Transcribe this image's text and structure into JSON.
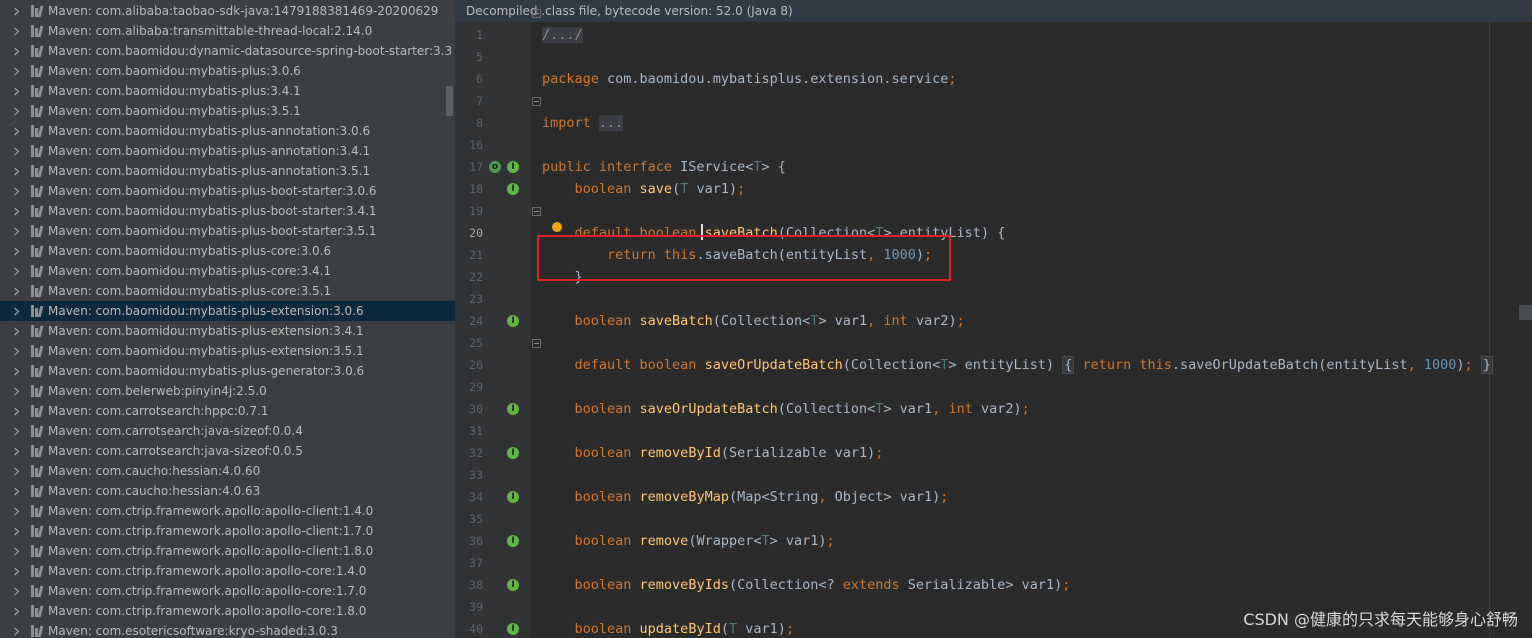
{
  "tree": {
    "items": [
      {
        "label": "Maven: com.alibaba:taobao-sdk-java:1479188381469-20200629"
      },
      {
        "label": "Maven: com.alibaba:transmittable-thread-local:2.14.0"
      },
      {
        "label": "Maven: com.baomidou:dynamic-datasource-spring-boot-starter:3.3"
      },
      {
        "label": "Maven: com.baomidou:mybatis-plus:3.0.6"
      },
      {
        "label": "Maven: com.baomidou:mybatis-plus:3.4.1"
      },
      {
        "label": "Maven: com.baomidou:mybatis-plus:3.5.1"
      },
      {
        "label": "Maven: com.baomidou:mybatis-plus-annotation:3.0.6"
      },
      {
        "label": "Maven: com.baomidou:mybatis-plus-annotation:3.4.1"
      },
      {
        "label": "Maven: com.baomidou:mybatis-plus-annotation:3.5.1"
      },
      {
        "label": "Maven: com.baomidou:mybatis-plus-boot-starter:3.0.6"
      },
      {
        "label": "Maven: com.baomidou:mybatis-plus-boot-starter:3.4.1"
      },
      {
        "label": "Maven: com.baomidou:mybatis-plus-boot-starter:3.5.1"
      },
      {
        "label": "Maven: com.baomidou:mybatis-plus-core:3.0.6"
      },
      {
        "label": "Maven: com.baomidou:mybatis-plus-core:3.4.1"
      },
      {
        "label": "Maven: com.baomidou:mybatis-plus-core:3.5.1"
      },
      {
        "label": "Maven: com.baomidou:mybatis-plus-extension:3.0.6",
        "selected": true
      },
      {
        "label": "Maven: com.baomidou:mybatis-plus-extension:3.4.1"
      },
      {
        "label": "Maven: com.baomidou:mybatis-plus-extension:3.5.1"
      },
      {
        "label": "Maven: com.baomidou:mybatis-plus-generator:3.0.6"
      },
      {
        "label": "Maven: com.belerweb:pinyin4j:2.5.0"
      },
      {
        "label": "Maven: com.carrotsearch:hppc:0.7.1"
      },
      {
        "label": "Maven: com.carrotsearch:java-sizeof:0.0.4"
      },
      {
        "label": "Maven: com.carrotsearch:java-sizeof:0.0.5"
      },
      {
        "label": "Maven: com.caucho:hessian:4.0.60"
      },
      {
        "label": "Maven: com.caucho:hessian:4.0.63"
      },
      {
        "label": "Maven: com.ctrip.framework.apollo:apollo-client:1.4.0"
      },
      {
        "label": "Maven: com.ctrip.framework.apollo:apollo-client:1.7.0"
      },
      {
        "label": "Maven: com.ctrip.framework.apollo:apollo-client:1.8.0"
      },
      {
        "label": "Maven: com.ctrip.framework.apollo:apollo-core:1.4.0"
      },
      {
        "label": "Maven: com.ctrip.framework.apollo:apollo-core:1.7.0"
      },
      {
        "label": "Maven: com.ctrip.framework.apollo:apollo-core:1.8.0"
      },
      {
        "label": "Maven: com.esotericsoftware:kryo-shaded:3.0.3"
      }
    ],
    "icons": {
      "expand": "chevron-right-icon",
      "library": "library-icon"
    }
  },
  "editor": {
    "banner": "Decompiled .class file, bytecode version: 52.0 (Java 8)",
    "current_line": "20",
    "lines": [
      {
        "num": "1",
        "gicons": [],
        "fold": true,
        "tokens": [
          {
            "t": "/.../",
            "c": "folded"
          }
        ]
      },
      {
        "num": "5",
        "gicons": [],
        "fold": false,
        "tokens": []
      },
      {
        "num": "6",
        "gicons": [],
        "fold": false,
        "tokens": [
          {
            "t": "package ",
            "c": "kw"
          },
          {
            "t": "com.baomidou.mybatisplus.extension.service",
            "c": ""
          },
          {
            "t": ";",
            "c": "kw"
          }
        ]
      },
      {
        "num": "7",
        "gicons": [],
        "fold": false,
        "tokens": []
      },
      {
        "num": "8",
        "gicons": [],
        "fold": true,
        "tokens": [
          {
            "t": "import ",
            "c": "kw"
          },
          {
            "t": "...",
            "c": "folded"
          }
        ]
      },
      {
        "num": "16",
        "gicons": [],
        "fold": false,
        "tokens": []
      },
      {
        "num": "17",
        "gicons": [
          "hier",
          "impl"
        ],
        "fold": false,
        "tokens": [
          {
            "t": "public interface ",
            "c": "kw"
          },
          {
            "t": "IService<",
            "c": ""
          },
          {
            "t": "T",
            "c": "tp"
          },
          {
            "t": "> {",
            "c": ""
          }
        ]
      },
      {
        "num": "18",
        "gicons": [
          "impl"
        ],
        "fold": false,
        "tokens": [
          {
            "t": "    boolean ",
            "c": "kw"
          },
          {
            "t": "save",
            "c": "fn"
          },
          {
            "t": "(",
            "c": ""
          },
          {
            "t": "T",
            "c": "tp"
          },
          {
            "t": " var1)",
            "c": ""
          },
          {
            "t": ";",
            "c": "kw"
          }
        ]
      },
      {
        "num": "19",
        "gicons": [],
        "fold": false,
        "tokens": []
      },
      {
        "num": "20",
        "gicons": [],
        "fold": true,
        "tokens": [
          {
            "t": "    default boolean ",
            "c": "kw"
          },
          {
            "t": "saveBatch",
            "c": "fn"
          },
          {
            "t": "(Collection<",
            "c": ""
          },
          {
            "t": "T",
            "c": "tp"
          },
          {
            "t": "> entityList) {",
            "c": ""
          }
        ]
      },
      {
        "num": "21",
        "gicons": [],
        "fold": false,
        "tokens": [
          {
            "t": "        return this",
            "c": "kw"
          },
          {
            "t": ".saveBatch(entityList",
            "c": ""
          },
          {
            "t": ", ",
            "c": "kw"
          },
          {
            "t": "1000",
            "c": "num"
          },
          {
            "t": ")",
            "c": ""
          },
          {
            "t": ";",
            "c": "kw"
          }
        ]
      },
      {
        "num": "22",
        "gicons": [],
        "fold": false,
        "tokens": [
          {
            "t": "    }",
            "c": ""
          }
        ]
      },
      {
        "num": "23",
        "gicons": [],
        "fold": false,
        "tokens": []
      },
      {
        "num": "24",
        "gicons": [
          "impl"
        ],
        "fold": false,
        "tokens": [
          {
            "t": "    boolean ",
            "c": "kw"
          },
          {
            "t": "saveBatch",
            "c": "fn"
          },
          {
            "t": "(Collection<",
            "c": ""
          },
          {
            "t": "T",
            "c": "tp"
          },
          {
            "t": "> var1",
            "c": ""
          },
          {
            "t": ", int ",
            "c": "kw"
          },
          {
            "t": "var2)",
            "c": ""
          },
          {
            "t": ";",
            "c": "kw"
          }
        ]
      },
      {
        "num": "25",
        "gicons": [],
        "fold": false,
        "tokens": []
      },
      {
        "num": "26",
        "gicons": [],
        "fold": true,
        "tokens": [
          {
            "t": "    default boolean ",
            "c": "kw"
          },
          {
            "t": "saveOrUpdateBatch",
            "c": "fn"
          },
          {
            "t": "(Collection<",
            "c": ""
          },
          {
            "t": "T",
            "c": "tp"
          },
          {
            "t": "> entityList) ",
            "c": ""
          },
          {
            "t": "{",
            "c": "braceblk"
          },
          {
            "t": " return this",
            "c": "kw"
          },
          {
            "t": ".saveOrUpdateBatch(entityList",
            "c": ""
          },
          {
            "t": ", ",
            "c": "kw"
          },
          {
            "t": "1000",
            "c": "num"
          },
          {
            "t": ")",
            "c": ""
          },
          {
            "t": ";",
            "c": "kw"
          },
          {
            "t": " ",
            "c": ""
          },
          {
            "t": "}",
            "c": "braceblk"
          }
        ]
      },
      {
        "num": "29",
        "gicons": [],
        "fold": false,
        "tokens": []
      },
      {
        "num": "30",
        "gicons": [
          "impl"
        ],
        "fold": false,
        "tokens": [
          {
            "t": "    boolean ",
            "c": "kw"
          },
          {
            "t": "saveOrUpdateBatch",
            "c": "fn"
          },
          {
            "t": "(Collection<",
            "c": ""
          },
          {
            "t": "T",
            "c": "tp"
          },
          {
            "t": "> var1",
            "c": ""
          },
          {
            "t": ", int ",
            "c": "kw"
          },
          {
            "t": "var2)",
            "c": ""
          },
          {
            "t": ";",
            "c": "kw"
          }
        ]
      },
      {
        "num": "31",
        "gicons": [],
        "fold": false,
        "tokens": []
      },
      {
        "num": "32",
        "gicons": [
          "impl"
        ],
        "fold": false,
        "tokens": [
          {
            "t": "    boolean ",
            "c": "kw"
          },
          {
            "t": "removeById",
            "c": "fn"
          },
          {
            "t": "(Serializable var1)",
            "c": ""
          },
          {
            "t": ";",
            "c": "kw"
          }
        ]
      },
      {
        "num": "33",
        "gicons": [],
        "fold": false,
        "tokens": []
      },
      {
        "num": "34",
        "gicons": [
          "impl"
        ],
        "fold": false,
        "tokens": [
          {
            "t": "    boolean ",
            "c": "kw"
          },
          {
            "t": "removeByMap",
            "c": "fn"
          },
          {
            "t": "(Map<String",
            "c": ""
          },
          {
            "t": ", ",
            "c": "kw"
          },
          {
            "t": "Object> var1)",
            "c": ""
          },
          {
            "t": ";",
            "c": "kw"
          }
        ]
      },
      {
        "num": "35",
        "gicons": [],
        "fold": false,
        "tokens": []
      },
      {
        "num": "36",
        "gicons": [
          "impl"
        ],
        "fold": false,
        "tokens": [
          {
            "t": "    boolean ",
            "c": "kw"
          },
          {
            "t": "remove",
            "c": "fn"
          },
          {
            "t": "(Wrapper<",
            "c": ""
          },
          {
            "t": "T",
            "c": "tp"
          },
          {
            "t": "> var1)",
            "c": ""
          },
          {
            "t": ";",
            "c": "kw"
          }
        ]
      },
      {
        "num": "37",
        "gicons": [],
        "fold": false,
        "tokens": []
      },
      {
        "num": "38",
        "gicons": [
          "impl"
        ],
        "fold": false,
        "tokens": [
          {
            "t": "    boolean ",
            "c": "kw"
          },
          {
            "t": "removeByIds",
            "c": "fn"
          },
          {
            "t": "(Collection<? ",
            "c": ""
          },
          {
            "t": "extends ",
            "c": "kw"
          },
          {
            "t": "Serializable> var1)",
            "c": ""
          },
          {
            "t": ";",
            "c": "kw"
          }
        ]
      },
      {
        "num": "39",
        "gicons": [],
        "fold": false,
        "tokens": []
      },
      {
        "num": "40",
        "gicons": [
          "impl"
        ],
        "fold": false,
        "tokens": [
          {
            "t": "    boolean ",
            "c": "kw"
          },
          {
            "t": "updateById",
            "c": "fn"
          },
          {
            "t": "(",
            "c": ""
          },
          {
            "t": "T",
            "c": "tp"
          },
          {
            "t": " var1)",
            "c": ""
          },
          {
            "t": ";",
            "c": "kw"
          }
        ]
      }
    ]
  },
  "footer_watermark": "CSDN @健康的只求每天能够身心舒畅",
  "colors": {
    "tree_bg": "#3c3f41",
    "tree_selected": "#0d293e",
    "editor_bg": "#2b2b2b",
    "keyword": "#cc7832",
    "method": "#ffc66d",
    "type_param": "#507874",
    "number": "#6897bb",
    "highlight_box": "#e0202a"
  }
}
